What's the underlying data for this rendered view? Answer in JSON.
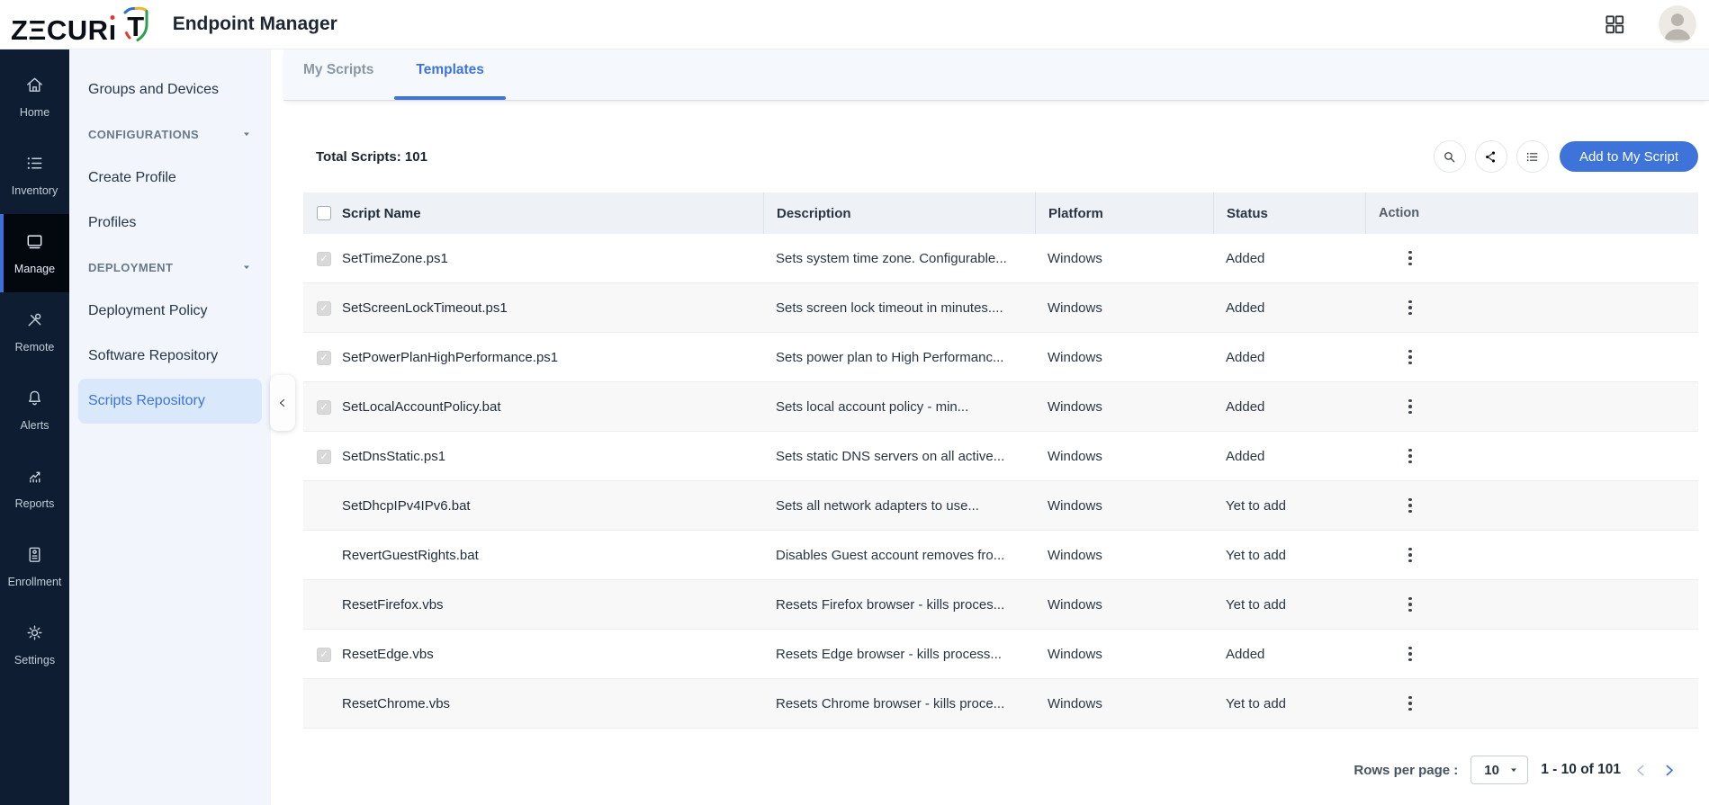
{
  "header": {
    "brand": {
      "prefix": "ZΞCUR",
      "dotless_i": "ı",
      "last": "T",
      "full_name": "ZECURIT"
    },
    "title": "Endpoint Manager",
    "icons": [
      {
        "icon": "apps-grid-icon"
      },
      {
        "icon": "user-avatar"
      }
    ]
  },
  "nav": {
    "items": [
      {
        "label": "Home",
        "icon": "home-icon",
        "active": false
      },
      {
        "label": "Inventory",
        "icon": "inventory-icon",
        "active": false
      },
      {
        "label": "Manage",
        "icon": "manage-icon",
        "active": true
      },
      {
        "label": "Remote",
        "icon": "remote-icon",
        "active": false
      },
      {
        "label": "Alerts",
        "icon": "alerts-icon",
        "active": false
      },
      {
        "label": "Reports",
        "icon": "reports-icon",
        "active": false
      },
      {
        "label": "Enrollment",
        "icon": "enrollment-icon",
        "active": false
      },
      {
        "label": "Settings",
        "icon": "settings-icon",
        "active": false
      }
    ]
  },
  "sidebar": {
    "items": [
      {
        "type": "link",
        "label": "Groups and Devices",
        "active": false
      },
      {
        "type": "section",
        "label": "CONFIGURATIONS"
      },
      {
        "type": "link",
        "label": "Create Profile",
        "active": false
      },
      {
        "type": "link",
        "label": "Profiles",
        "active": false
      },
      {
        "type": "section",
        "label": "DEPLOYMENT"
      },
      {
        "type": "link",
        "label": "Deployment Policy",
        "active": false
      },
      {
        "type": "link",
        "label": "Software Repository",
        "active": false
      },
      {
        "type": "link",
        "label": "Scripts Repository",
        "active": true
      }
    ]
  },
  "tabs": [
    {
      "label": "My Scripts",
      "active": false
    },
    {
      "label": "Templates",
      "active": true
    }
  ],
  "toolbar": {
    "total_label": "Total Scripts: 101",
    "icon_buttons": [
      {
        "icon": "search-icon"
      },
      {
        "icon": "share-icon"
      },
      {
        "icon": "list-view-icon"
      }
    ],
    "add_button_label": "Add to My Script"
  },
  "table": {
    "columns": [
      "Script Name",
      "Description",
      "Platform",
      "Status",
      "Action"
    ],
    "rows": [
      {
        "name": "SetTimeZone.ps1",
        "description": "Sets system time zone. Configurable...",
        "platform": "Windows",
        "status": "Added",
        "checked": true
      },
      {
        "name": "SetScreenLockTimeout.ps1",
        "description": "Sets screen lock timeout in minutes....",
        "platform": "Windows",
        "status": "Added",
        "checked": true
      },
      {
        "name": "SetPowerPlanHighPerformance.ps1",
        "description": "Sets power plan to High Performanc...",
        "platform": "Windows",
        "status": "Added",
        "checked": true
      },
      {
        "name": "SetLocalAccountPolicy.bat",
        "description": "Sets local account policy - min...",
        "platform": "Windows",
        "status": "Added",
        "checked": true
      },
      {
        "name": "SetDnsStatic.ps1",
        "description": "Sets static DNS servers on all active...",
        "platform": "Windows",
        "status": "Added",
        "checked": true
      },
      {
        "name": "SetDhcpIPv4IPv6.bat",
        "description": "Sets all network adapters to use...",
        "platform": "Windows",
        "status": "Yet to add",
        "checked": false
      },
      {
        "name": "RevertGuestRights.bat",
        "description": "Disables Guest account removes fro...",
        "platform": "Windows",
        "status": "Yet to add",
        "checked": false
      },
      {
        "name": "ResetFirefox.vbs",
        "description": "Resets Firefox browser - kills proces...",
        "platform": "Windows",
        "status": "Yet to add",
        "checked": false
      },
      {
        "name": "ResetEdge.vbs",
        "description": "Resets Edge browser - kills process...",
        "platform": "Windows",
        "status": "Added",
        "checked": true
      },
      {
        "name": "ResetChrome.vbs",
        "description": "Resets Chrome browser - kills proce...",
        "platform": "Windows",
        "status": "Yet to add",
        "checked": false
      }
    ]
  },
  "pagination": {
    "rows_per_page_label": "Rows per page :",
    "rows_per_page_value": "10",
    "range_label": "1 - 10 of 101"
  },
  "colors": {
    "accent_blue": "#3e74d9",
    "nav_bg": "#0e1d31",
    "nav_active_bg": "#03080f",
    "sidebar_bg": "#f2f6fc",
    "sidebar_active_pill": "#d9e8fb",
    "tabbar_bg": "#f5f8fd",
    "table_header_bg": "#eef1f6",
    "row_alt_bg": "#f8f8f9",
    "logo_red": "#e23b2e",
    "logo_blue": "#2f6fd0",
    "logo_green": "#2e9e4f",
    "logo_yellow": "#f0b429"
  }
}
